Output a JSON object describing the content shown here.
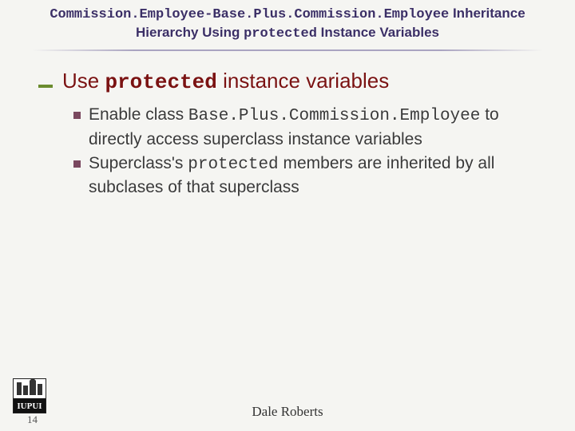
{
  "title": {
    "code1": "Commission.Employee",
    "dash": "-",
    "code2": "Base.Plus.Commission.Employee",
    "rest_line1": " Inheritance",
    "line2a": "Hierarchy Using ",
    "kw": "protected",
    "line2b": " Instance Variables"
  },
  "headline": {
    "pre": "Use ",
    "kw": "protected",
    "post": " instance variables"
  },
  "bullets": [
    {
      "pre": "Enable class ",
      "code": "Base.Plus.Commission.Employee",
      "post": " to directly access superclass instance variables"
    },
    {
      "pre": "Superclass's ",
      "code": "protected",
      "post": " members are inherited by all subclases of that superclass"
    }
  ],
  "footer": {
    "slide_number": "14",
    "author": "Dale Roberts",
    "logo_alt": "IUPUI"
  }
}
